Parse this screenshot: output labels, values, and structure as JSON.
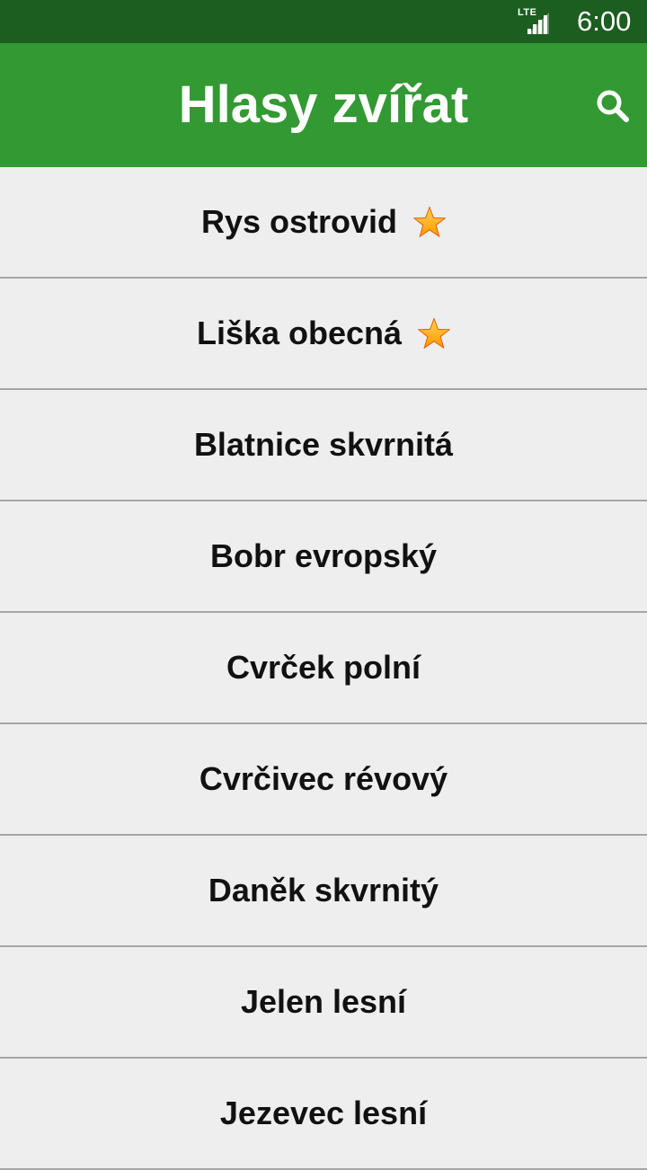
{
  "status_bar": {
    "network": "LTE",
    "time": "6:00"
  },
  "app_bar": {
    "title": "Hlasy zvířat",
    "search_icon": "search-icon"
  },
  "colors": {
    "status_bar": "#1b5e20",
    "app_bar": "#339933",
    "list_background": "#eeeeee",
    "divider": "#a6a6a6",
    "star": "#ff9800"
  },
  "animals": [
    {
      "name": "Rys ostrovid",
      "favorite": true
    },
    {
      "name": "Liška obecná",
      "favorite": true
    },
    {
      "name": "Blatnice skvrnitá",
      "favorite": false
    },
    {
      "name": "Bobr evropský",
      "favorite": false
    },
    {
      "name": "Cvrček polní",
      "favorite": false
    },
    {
      "name": "Cvrčivec révový",
      "favorite": false
    },
    {
      "name": "Daněk skvrnitý",
      "favorite": false
    },
    {
      "name": "Jelen lesní",
      "favorite": false
    },
    {
      "name": "Jezevec lesní",
      "favorite": false
    }
  ]
}
